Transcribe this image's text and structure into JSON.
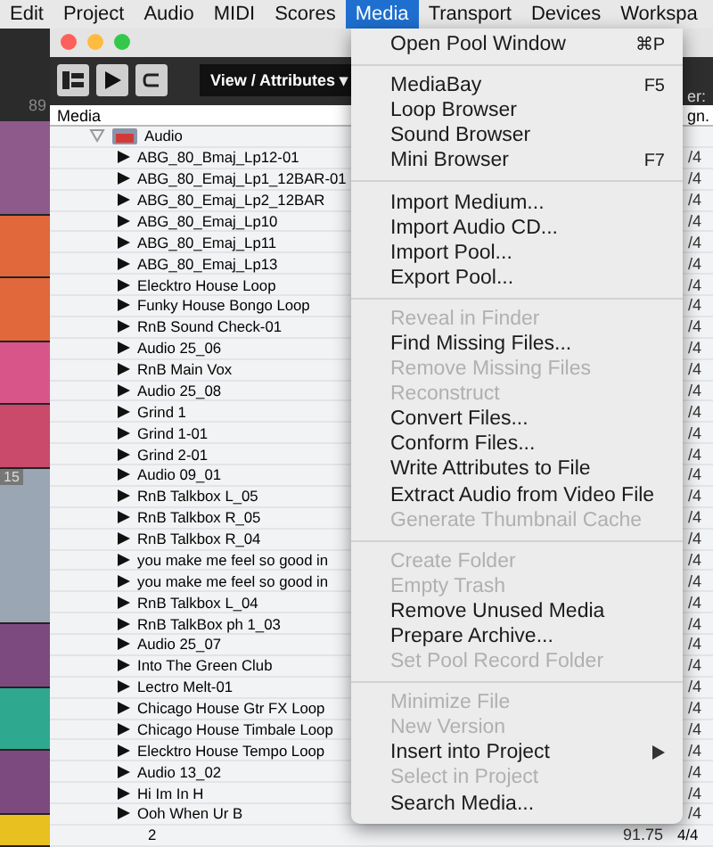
{
  "menubar": [
    {
      "label": "Edit",
      "selected": false
    },
    {
      "label": "Project",
      "selected": false
    },
    {
      "label": "Audio",
      "selected": false
    },
    {
      "label": "MIDI",
      "selected": false
    },
    {
      "label": "Scores",
      "selected": false
    },
    {
      "label": "Media",
      "selected": true
    },
    {
      "label": "Transport",
      "selected": false
    },
    {
      "label": "Devices",
      "selected": false
    },
    {
      "label": "Workspa",
      "selected": false
    }
  ],
  "tracks": {
    "number": "89",
    "marker": "15",
    "strips": [
      {
        "color": "#8e5a8c"
      },
      {
        "color": "#e0683a"
      },
      {
        "color": "#e0683a"
      },
      {
        "color": "#d8558a"
      },
      {
        "color": "#c94a6a"
      },
      {
        "color": "#9aa6b4"
      },
      {
        "color": "#7d4a80"
      },
      {
        "color": "#2fa890"
      },
      {
        "color": "#7d4a80"
      },
      {
        "color": "#e8c020"
      }
    ]
  },
  "pool": {
    "view_button": "View / Attributes",
    "view_caret": "▾",
    "column_header": "Media",
    "right_header_top": "er:",
    "right_header": "gn.",
    "folder": {
      "label": "Audio",
      "expanded": true
    },
    "rows": [
      {
        "name": "ABG_80_Bmaj_Lp12-01",
        "sig": "/4"
      },
      {
        "name": "ABG_80_Emaj_Lp1_12BAR-01",
        "sig": "/4"
      },
      {
        "name": "ABG_80_Emaj_Lp2_12BAR",
        "sig": "/4"
      },
      {
        "name": "ABG_80_Emaj_Lp10",
        "sig": "/4"
      },
      {
        "name": "ABG_80_Emaj_Lp11",
        "sig": "/4"
      },
      {
        "name": "ABG_80_Emaj_Lp13",
        "sig": "/4"
      },
      {
        "name": "Elecktro House Loop",
        "sig": "/4"
      },
      {
        "name": "Funky House Bongo Loop",
        "sig": "/4"
      },
      {
        "name": "RnB Sound Check-01",
        "sig": "/4"
      },
      {
        "name": "Audio 25_06",
        "sig": "/4"
      },
      {
        "name": "RnB Main Vox",
        "sig": "/4"
      },
      {
        "name": "Audio 25_08",
        "sig": "/4"
      },
      {
        "name": "Grind 1",
        "sig": "/4"
      },
      {
        "name": "Grind 1-01",
        "sig": "/4"
      },
      {
        "name": "Grind 2-01",
        "sig": "/4"
      },
      {
        "name": "Audio 09_01",
        "sig": "/4"
      },
      {
        "name": "RnB Talkbox L_05",
        "sig": "/4"
      },
      {
        "name": "RnB Talkbox R_05",
        "sig": "/4"
      },
      {
        "name": "RnB Talkbox R_04",
        "sig": "/4"
      },
      {
        "name": "you make me feel so good in",
        "sig": "/4"
      },
      {
        "name": "you make me feel so good in",
        "sig": "/4"
      },
      {
        "name": "RnB Talkbox L_04",
        "sig": "/4"
      },
      {
        "name": "RnB TalkBox ph 1_03",
        "sig": "/4"
      },
      {
        "name": "Audio 25_07",
        "sig": "/4"
      },
      {
        "name": "Into The Green Club",
        "sig": "/4"
      },
      {
        "name": "Lectro Melt-01",
        "sig": "/4"
      },
      {
        "name": "Chicago House Gtr FX Loop",
        "sig": "/4"
      },
      {
        "name": "Chicago House Timbale Loop",
        "sig": "/4"
      },
      {
        "name": "Elecktro House Tempo Loop",
        "sig": "/4"
      },
      {
        "name": "Audio 13_02",
        "sig": "/4"
      },
      {
        "name": "Hi Im In H",
        "sig": "/4"
      },
      {
        "name": "Ooh When Ur B",
        "sig": "/4"
      }
    ],
    "bottom_row": {
      "count": "2",
      "tempo": "91.75",
      "sig": "4/4"
    }
  },
  "menu": [
    {
      "kind": "item",
      "label": "Open Pool Window",
      "shortcut": "⌘P",
      "disabled": false
    },
    {
      "kind": "separator"
    },
    {
      "kind": "item",
      "label": "MediaBay",
      "shortcut": "F5",
      "disabled": false
    },
    {
      "kind": "item",
      "label": "Loop Browser",
      "disabled": false
    },
    {
      "kind": "item",
      "label": "Sound Browser",
      "disabled": false
    },
    {
      "kind": "item",
      "label": "Mini Browser",
      "shortcut": "F7",
      "disabled": false
    },
    {
      "kind": "separator"
    },
    {
      "kind": "item",
      "label": "Import Medium...",
      "disabled": false
    },
    {
      "kind": "item",
      "label": "Import Audio CD...",
      "disabled": false
    },
    {
      "kind": "item",
      "label": "Import Pool...",
      "disabled": false
    },
    {
      "kind": "item",
      "label": "Export Pool...",
      "disabled": false
    },
    {
      "kind": "separator"
    },
    {
      "kind": "item",
      "label": "Reveal in Finder",
      "disabled": true
    },
    {
      "kind": "item",
      "label": "Find Missing Files...",
      "disabled": false
    },
    {
      "kind": "item",
      "label": "Remove Missing Files",
      "disabled": true
    },
    {
      "kind": "item",
      "label": "Reconstruct",
      "disabled": true
    },
    {
      "kind": "item",
      "label": "Convert Files...",
      "disabled": false
    },
    {
      "kind": "item",
      "label": "Conform Files...",
      "disabled": false
    },
    {
      "kind": "item",
      "label": "Write Attributes to File",
      "disabled": false
    },
    {
      "kind": "item",
      "label": "Extract Audio from Video File",
      "disabled": false
    },
    {
      "kind": "item",
      "label": "Generate Thumbnail Cache",
      "disabled": true
    },
    {
      "kind": "separator"
    },
    {
      "kind": "item",
      "label": "Create Folder",
      "disabled": true
    },
    {
      "kind": "item",
      "label": "Empty Trash",
      "disabled": true
    },
    {
      "kind": "item",
      "label": "Remove Unused Media",
      "disabled": false
    },
    {
      "kind": "item",
      "label": "Prepare Archive...",
      "disabled": false
    },
    {
      "kind": "item",
      "label": "Set Pool Record Folder",
      "disabled": true
    },
    {
      "kind": "separator"
    },
    {
      "kind": "item",
      "label": "Minimize File",
      "disabled": true
    },
    {
      "kind": "item",
      "label": "New Version",
      "disabled": true
    },
    {
      "kind": "item",
      "label": "Insert into Project",
      "disabled": false,
      "submenu": true
    },
    {
      "kind": "item",
      "label": "Select in Project",
      "disabled": true
    },
    {
      "kind": "item",
      "label": "Search Media...",
      "disabled": false
    }
  ]
}
